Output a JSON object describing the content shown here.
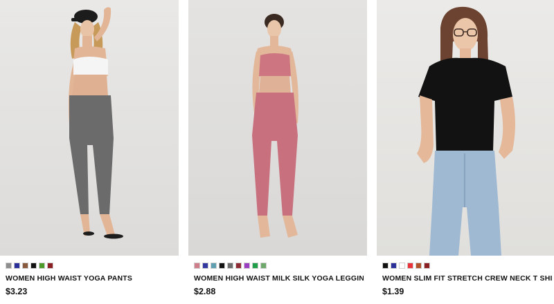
{
  "products": [
    {
      "name": "WOMEN HIGH WAIST YOGA PANTS",
      "price": "$3.23",
      "swatches": [
        "#8e8e8e",
        "#2a2f9a",
        "#8a5a3c",
        "#111111",
        "#4c9a2a",
        "#8c1f24"
      ]
    },
    {
      "name": "WOMEN HIGH WAIST MILK SILK YOGA LEGGINGS ...",
      "price": "$2.88",
      "swatches": [
        "#cf7f8c",
        "#3338a0",
        "#5f9fb0",
        "#121212",
        "#6d6d6d",
        "#8d2a33",
        "#9b3fc2",
        "#1f9f4a",
        "#6ea86a"
      ]
    },
    {
      "name": "WOMEN SLIM FIT STRETCH CREW NECK T SHIRT",
      "price": "$1.39",
      "swatches": [
        "#111111",
        "#2a2f9a",
        "#ffffff",
        "#e8343a",
        "#b0522b",
        "#8c1f24"
      ]
    }
  ]
}
